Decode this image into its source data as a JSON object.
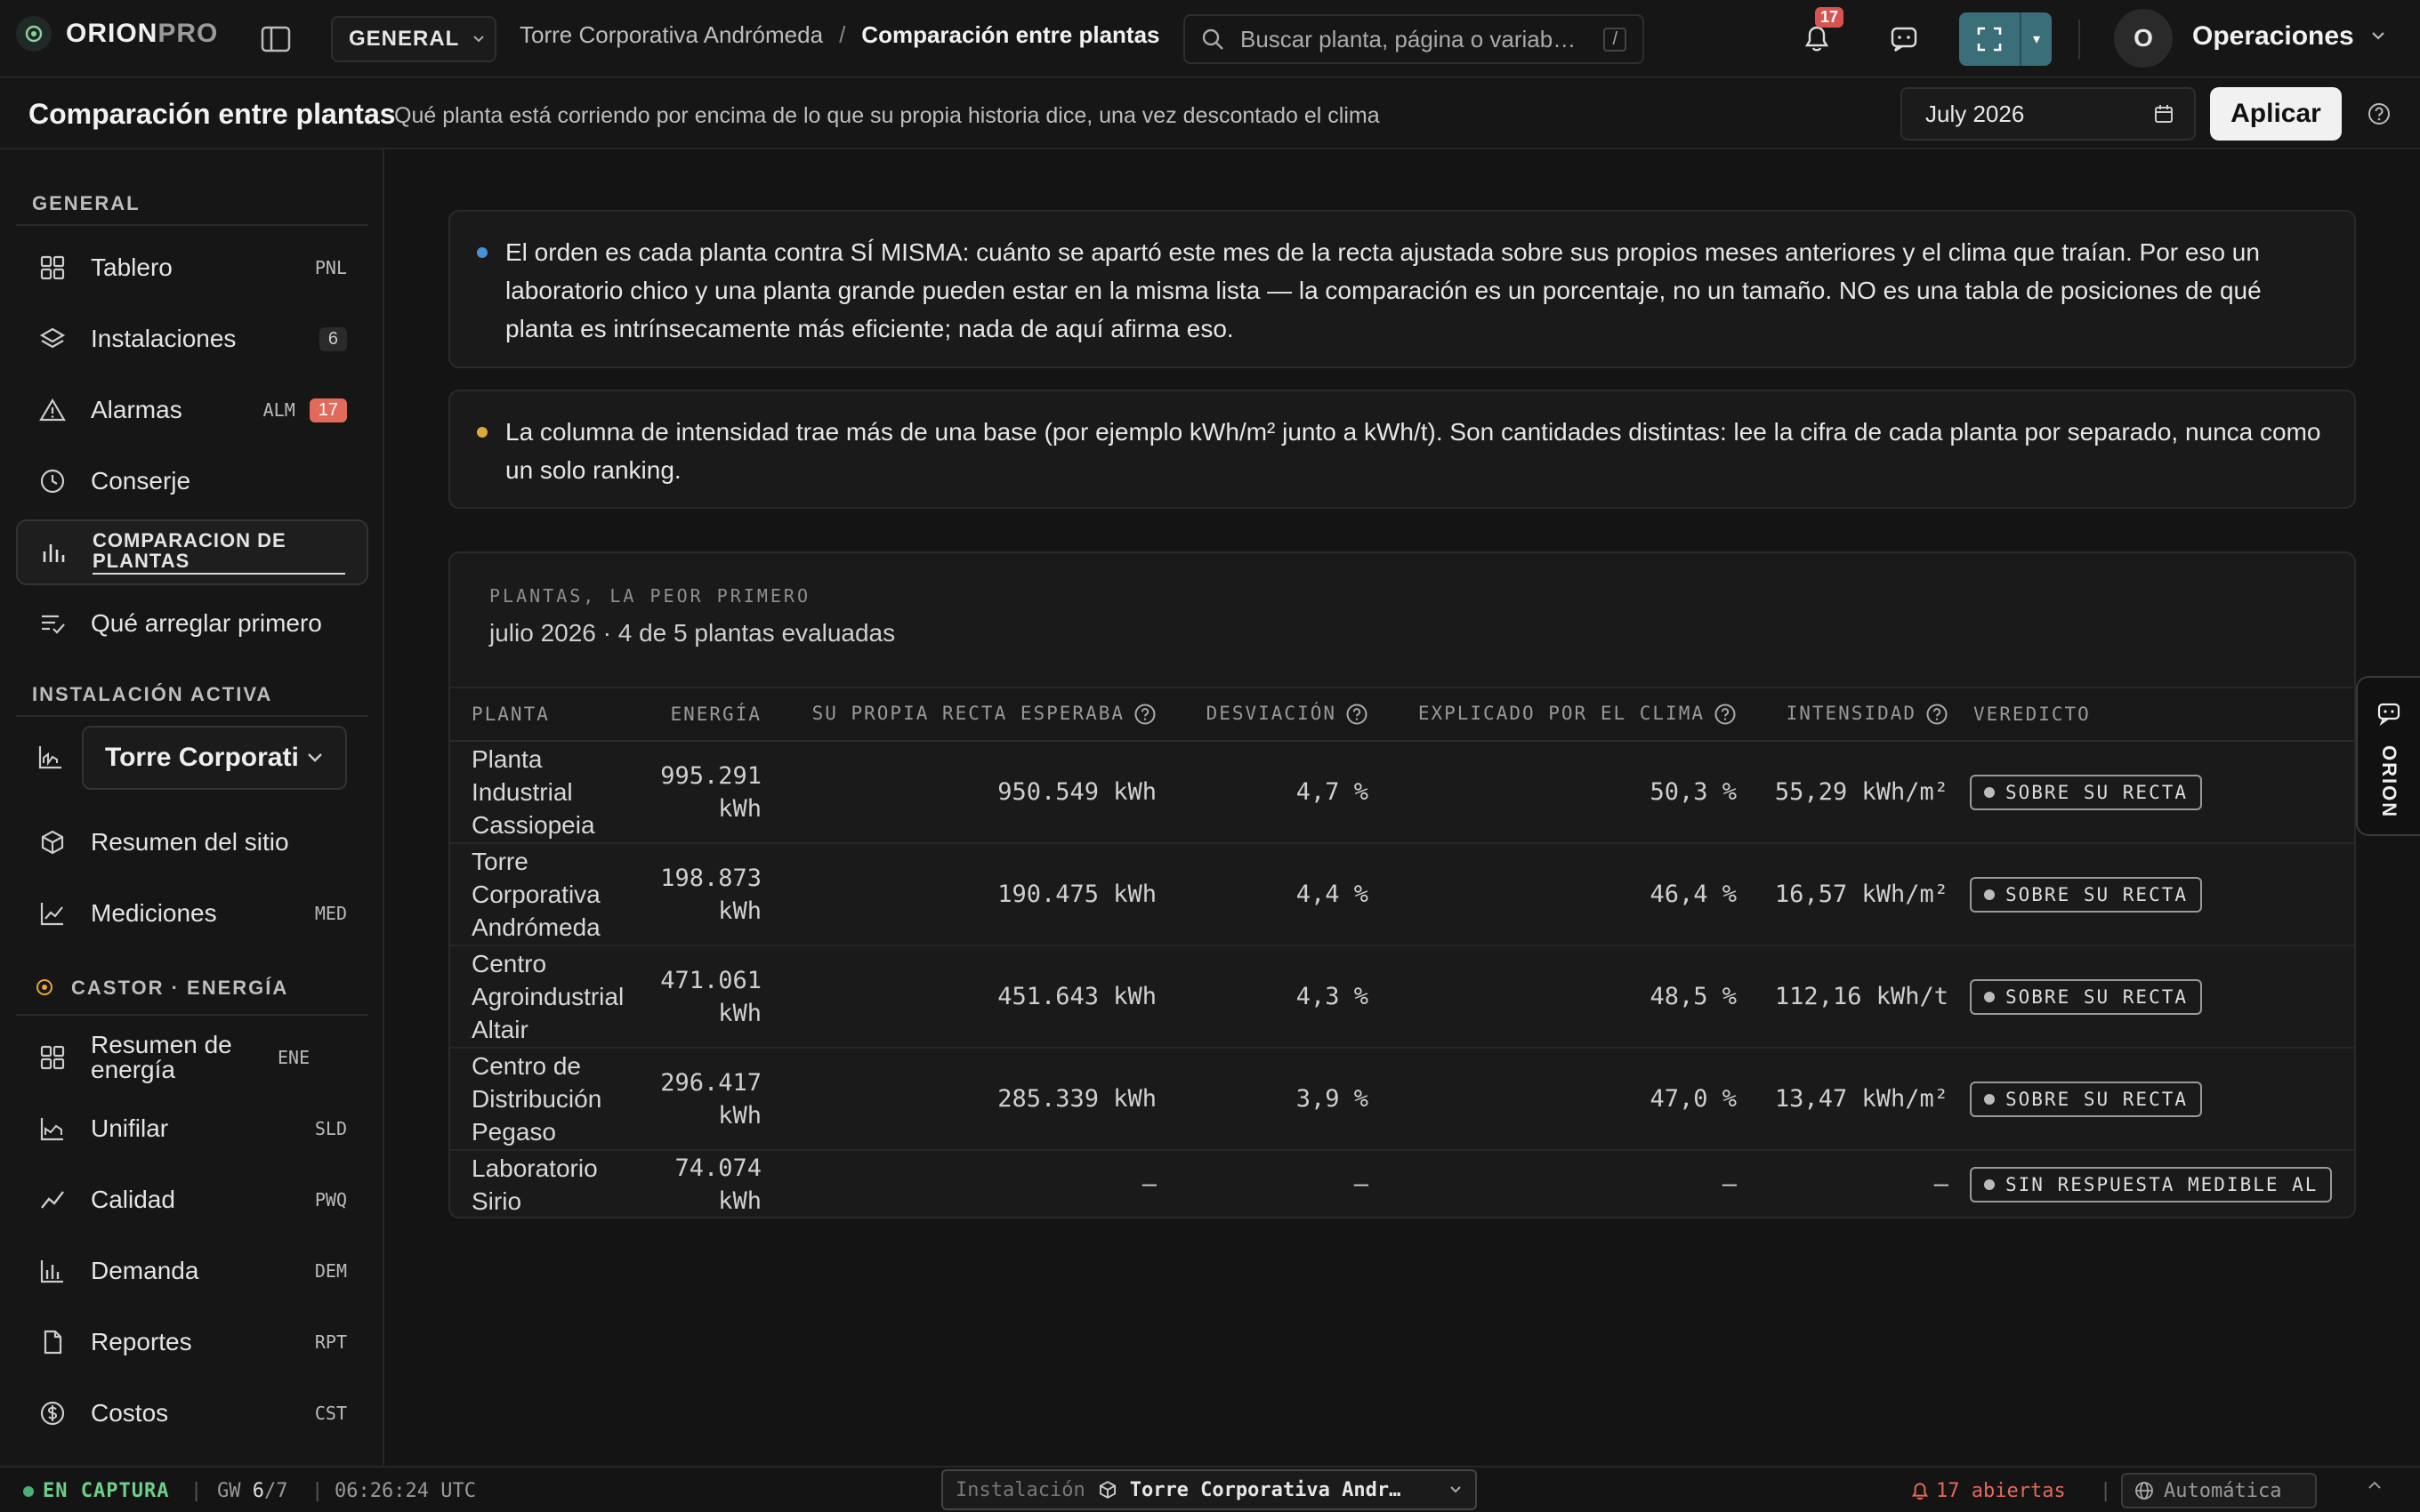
{
  "app": {
    "brand": "ORIONPRO",
    "brand_strong": "ORION",
    "brand_light": "PRO",
    "workspace": "GENERAL",
    "breadcrumb": {
      "parent": "Torre Corporativa Andrómeda",
      "separator": "/",
      "current": "Comparación entre plantas"
    },
    "search": {
      "placeholder": "Buscar planta, página o variab…",
      "shortcut": "/"
    },
    "notifications_count": "17",
    "user": {
      "initial": "O",
      "name": "Operaciones"
    }
  },
  "page": {
    "title": "Comparación entre plantas",
    "subtitle": "Qué planta está corriendo por encima de lo que su propia historia dice, una vez descontado el clima",
    "month": "July 2026",
    "apply_label": "Aplicar"
  },
  "sidebar": {
    "section_general": "GENERAL",
    "general_items": [
      {
        "label": "Tablero",
        "code": "PNL"
      },
      {
        "label": "Instalaciones",
        "badge": "6"
      },
      {
        "label": "Alarmas",
        "code": "ALM",
        "badge": "17"
      },
      {
        "label": "Conserje"
      },
      {
        "label": "COMPARACION DE PLANTAS"
      },
      {
        "label": "Qué arreglar primero"
      }
    ],
    "section_active": "INSTALACIÓN ACTIVA",
    "active_facility": "Torre Corporativa Andrómeda",
    "site_items": [
      {
        "label": "Resumen del sitio"
      },
      {
        "label": "Mediciones",
        "code": "MED"
      }
    ],
    "section_energy": "CASTOR · ENERGÍA",
    "energy_items": [
      {
        "label": "Resumen de energía",
        "code": "ENE"
      },
      {
        "label": "Unifilar",
        "code": "SLD"
      },
      {
        "label": "Calidad",
        "code": "PWQ"
      },
      {
        "label": "Demanda",
        "code": "DEM"
      },
      {
        "label": "Reportes",
        "code": "RPT"
      },
      {
        "label": "Costos",
        "code": "CST"
      }
    ]
  },
  "notices": [
    {
      "text": "El orden es cada planta contra SÍ MISMA: cuánto se apartó este mes de la recta ajustada sobre sus propios meses anteriores y el clima que traían. Por eso un laboratorio chico y una planta grande pueden estar en la misma lista — la comparación es un porcentaje, no un tamaño. NO es una tabla de posiciones de qué planta es intrínsecamente más eficiente; nada de aquí afirma eso.",
      "color": "#4a90d9"
    },
    {
      "text": "La columna de intensidad trae más de una base (por ejemplo kWh/m² junto a kWh/t). Son cantidades distintas: lee la cifra de cada planta por separado, nunca como un solo ranking.",
      "color": "#e0a83a"
    }
  ],
  "table": {
    "kicker": "PLANTAS, LA PEOR PRIMERO",
    "caption": "julio 2026 · 4 de 5 plantas evaluadas",
    "columns": [
      "PLANTA",
      "ENERGÍA",
      "SU PROPIA RECTA ESPERABA",
      "DESVIACIÓN",
      "EXPLICADO POR EL CLIMA",
      "INTENSIDAD",
      "VEREDICTO"
    ],
    "rows": [
      {
        "plant": "Planta Industrial Cassiopeia",
        "energy": "995.291 kWh",
        "expected": "950.549 kWh",
        "deviation": "4,7 %",
        "climate": "50,3 %",
        "intensity": "55,29 kWh/m²",
        "verdict": "SOBRE SU RECTA"
      },
      {
        "plant": "Torre Corporativa Andrómeda",
        "energy": "198.873 kWh",
        "expected": "190.475 kWh",
        "deviation": "4,4 %",
        "climate": "46,4 %",
        "intensity": "16,57 kWh/m²",
        "verdict": "SOBRE SU RECTA"
      },
      {
        "plant": "Centro Agroindustrial Altair",
        "energy": "471.061 kWh",
        "expected": "451.643 kWh",
        "deviation": "4,3 %",
        "climate": "48,5 %",
        "intensity": "112,16 kWh/t",
        "verdict": "SOBRE SU RECTA"
      },
      {
        "plant": "Centro de Distribución Pegaso",
        "energy": "296.417 kWh",
        "expected": "285.339 kWh",
        "deviation": "3,9 %",
        "climate": "47,0 %",
        "intensity": "13,47 kWh/m²",
        "verdict": "SOBRE SU RECTA"
      },
      {
        "plant": "Laboratorio Sirio",
        "energy": "74.074 kWh",
        "expected": "—",
        "deviation": "—",
        "climate": "—",
        "intensity": "—",
        "verdict": "SIN RESPUESTA MEDIBLE AL"
      }
    ]
  },
  "assistant_tab": "ORION",
  "statusbar": {
    "capture": "EN CAPTURA",
    "gw_label": "GW",
    "gw_value": "6",
    "gw_total": "/7",
    "time": "06:26:24 UTC",
    "facility_label": "Instalación",
    "facility_value": "Torre Corporativa Andr…",
    "open_alarms": "17 abiertas",
    "mode": "Automática"
  },
  "colors": {
    "accent_teal": "#3a6e78",
    "alarm_red": "#e26a5a",
    "capture_green": "#4caf73",
    "notice_blue": "#4a90d9",
    "notice_amber": "#e0a83a"
  }
}
